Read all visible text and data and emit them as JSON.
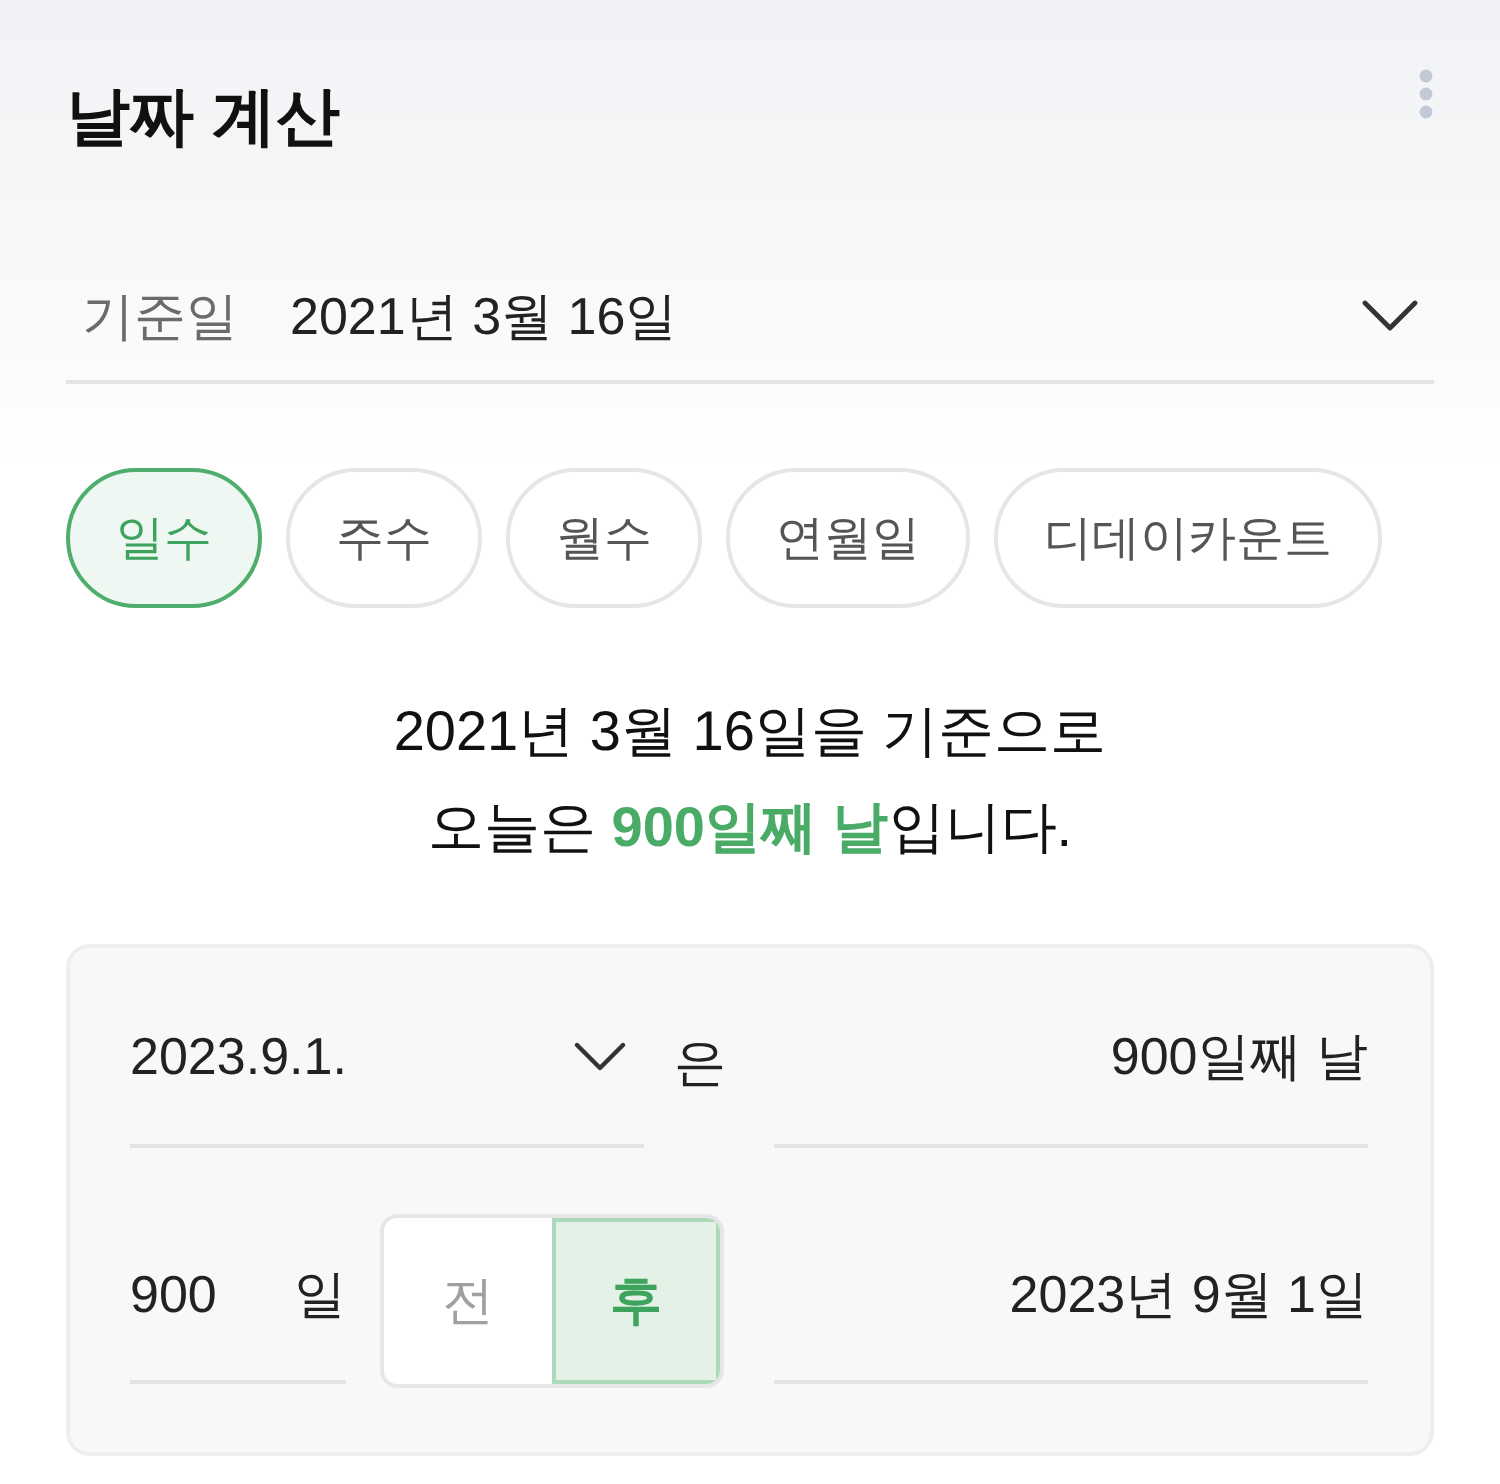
{
  "header": {
    "title": "날짜 계산"
  },
  "base_date": {
    "label": "기준일",
    "value": "2021년 3월 16일"
  },
  "tabs": [
    {
      "label": "일수",
      "selected": true
    },
    {
      "label": "주수",
      "selected": false
    },
    {
      "label": "월수",
      "selected": false
    },
    {
      "label": "연월일",
      "selected": false
    },
    {
      "label": "디데이카운트",
      "selected": false
    }
  ],
  "summary": {
    "lines": [
      "2021년 3월 16일을 기준으로",
      "오늘은 **900일째 날**입니다."
    ]
  },
  "calculator": {
    "rows": [
      {
        "kind": "date",
        "input": "2023.9.1.",
        "particle": "은",
        "result": "900일째 날"
      },
      {
        "kind": "offset",
        "input": "900",
        "unit": "일",
        "directions": [
          {
            "label": "전",
            "selected": false
          },
          {
            "label": "후",
            "selected": true
          }
        ],
        "result": "2023년 9월 1일"
      }
    ]
  }
}
